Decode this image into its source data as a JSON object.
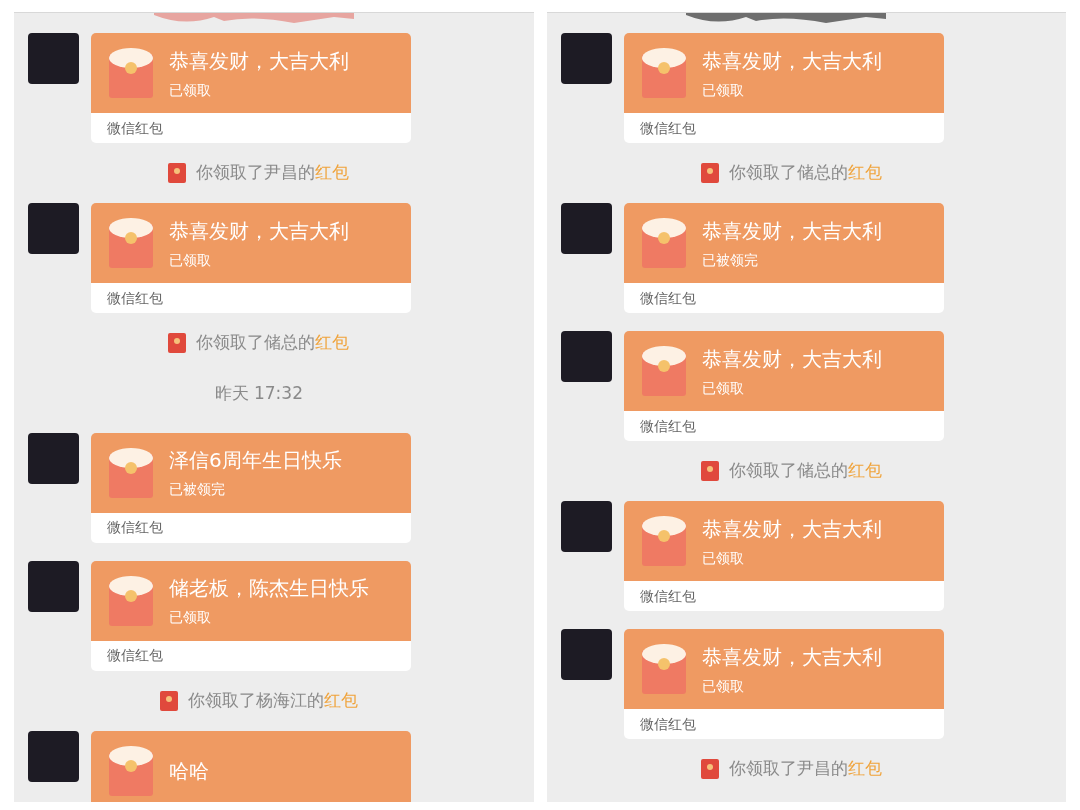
{
  "panels": [
    {
      "messages": [
        {
          "kind": "packet",
          "title": "恭喜发财，大吉大利",
          "status": "已领取",
          "footer": "微信红包"
        },
        {
          "kind": "notice",
          "text": "你领取了尹昌的",
          "link": "红包"
        },
        {
          "kind": "packet",
          "title": "恭喜发财，大吉大利",
          "status": "已领取",
          "footer": "微信红包"
        },
        {
          "kind": "notice",
          "text": "你领取了储总的",
          "link": "红包"
        },
        {
          "kind": "time",
          "text": "昨天 17:32"
        },
        {
          "kind": "packet",
          "title": "泽信6周年生日快乐",
          "status": "已被领完",
          "footer": "微信红包"
        },
        {
          "kind": "packet",
          "title": "储老板，陈杰生日快乐",
          "status": "已领取",
          "footer": "微信红包"
        },
        {
          "kind": "notice",
          "text": "你领取了杨海江的",
          "link": "红包"
        },
        {
          "kind": "packet",
          "title": "哈哈"
        }
      ]
    },
    {
      "messages": [
        {
          "kind": "packet",
          "title": "恭喜发财，大吉大利",
          "status": "已领取",
          "footer": "微信红包"
        },
        {
          "kind": "notice",
          "text": "你领取了储总的",
          "link": "红包"
        },
        {
          "kind": "packet",
          "title": "恭喜发财，大吉大利",
          "status": "已被领完",
          "footer": "微信红包"
        },
        {
          "kind": "packet",
          "title": "恭喜发财，大吉大利",
          "status": "已领取",
          "footer": "微信红包"
        },
        {
          "kind": "notice",
          "text": "你领取了储总的",
          "link": "红包"
        },
        {
          "kind": "packet",
          "title": "恭喜发财，大吉大利",
          "status": "已领取",
          "footer": "微信红包"
        },
        {
          "kind": "packet",
          "title": "恭喜发财，大吉大利",
          "status": "已领取",
          "footer": "微信红包"
        },
        {
          "kind": "notice",
          "text": "你领取了尹昌的",
          "link": "红包"
        }
      ]
    }
  ]
}
